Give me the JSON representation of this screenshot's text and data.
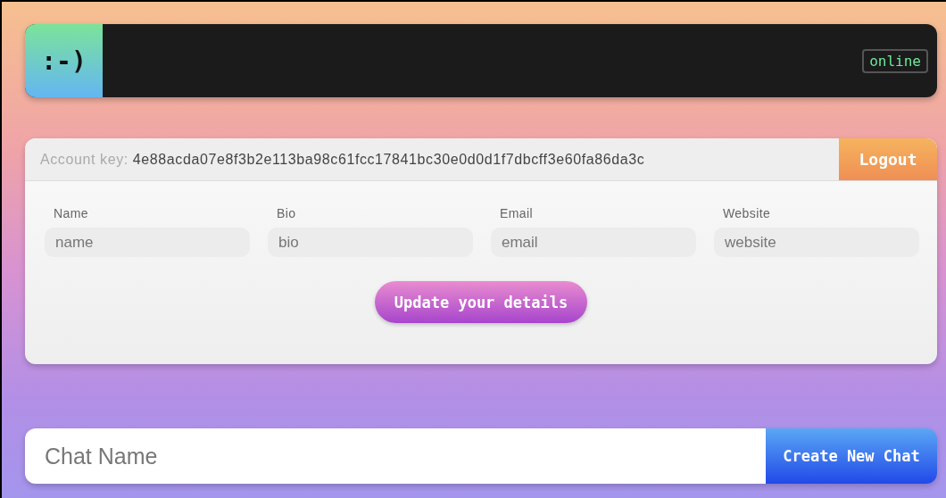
{
  "header": {
    "logo": ":-)",
    "status": "online"
  },
  "account": {
    "label": "Account key:",
    "key": "4e88acda07e8f3b2e113ba98c61fcc17841bc30e0d0d1f7dbcff3e60fa86da3c",
    "logout": "Logout"
  },
  "fields": [
    {
      "label": "Name",
      "placeholder": "name"
    },
    {
      "label": "Bio",
      "placeholder": "bio"
    },
    {
      "label": "Email",
      "placeholder": "email"
    },
    {
      "label": "Website",
      "placeholder": "website"
    }
  ],
  "update_button": "Update your details",
  "chat": {
    "placeholder": "Chat Name",
    "button": "Create New Chat"
  }
}
